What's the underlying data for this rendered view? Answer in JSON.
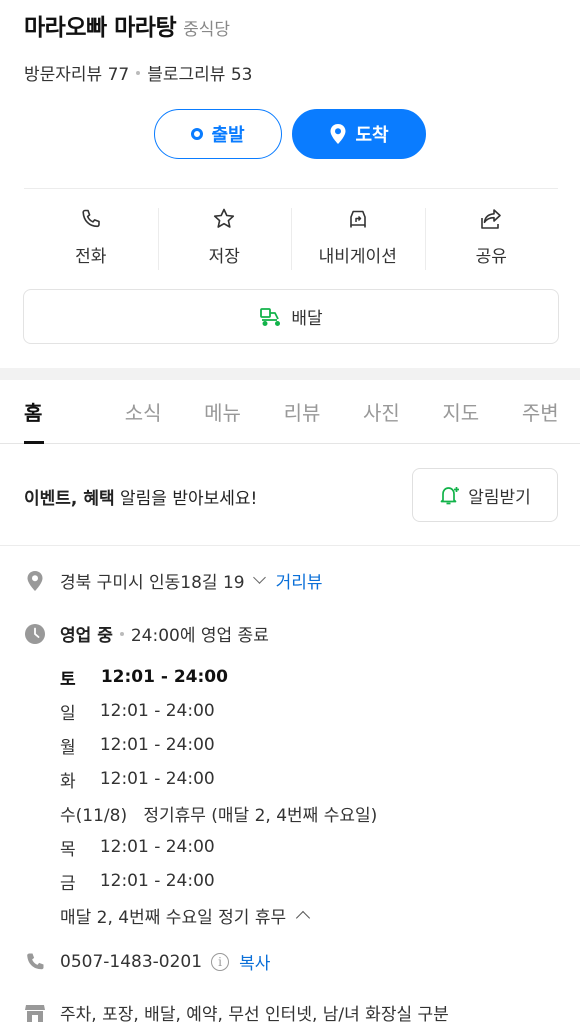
{
  "place": {
    "name": "마라오빠 마라탕",
    "category": "중식당",
    "visitor_reviews": "방문자리뷰 77",
    "blog_reviews": "블로그리뷰 53"
  },
  "route": {
    "depart_label": "출발",
    "arrive_label": "도착"
  },
  "actions": {
    "call": "전화",
    "save": "저장",
    "navigation": "내비게이션",
    "share": "공유"
  },
  "delivery_label": "배달",
  "tabs": [
    "홈",
    "소식",
    "메뉴",
    "리뷰",
    "사진",
    "지도",
    "주변"
  ],
  "notification": {
    "text_bold_1": "이벤트",
    "text_sep": ", ",
    "text_bold_2": "혜택",
    "text_rest": " 알림을 받아보세요!",
    "button_label": "알림받기"
  },
  "address": {
    "text": "경북 구미시 인동18길 19",
    "street_view": "거리뷰"
  },
  "business": {
    "status": "영업 중",
    "closing": "24:00에 영업 종료",
    "hours": [
      {
        "day": "토",
        "time": "12:01 - 24:00"
      },
      {
        "day": "일",
        "time": "12:01 - 24:00"
      },
      {
        "day": "월",
        "time": "12:01 - 24:00"
      },
      {
        "day": "화",
        "time": "12:01 - 24:00"
      },
      {
        "day": "수(11/8)",
        "time": "정기휴무 (매달 2, 4번째 수요일)"
      },
      {
        "day": "목",
        "time": "12:01 - 24:00"
      },
      {
        "day": "금",
        "time": "12:01 - 24:00"
      }
    ],
    "holiday_note": "매달 2, 4번째 수요일 정기 휴무"
  },
  "phone": {
    "number": "0507-1483-0201",
    "info_glyph": "i",
    "copy_label": "복사"
  },
  "amenities": "주차, 포장, 배달, 예약, 무선 인터넷, 남/녀 화장실 구분",
  "colors": {
    "accent": "#0a7cff",
    "link": "#0a6fd8",
    "delivery_green": "#12b34a"
  }
}
